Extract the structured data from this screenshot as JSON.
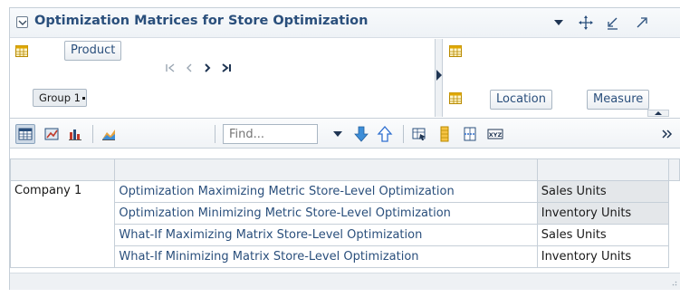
{
  "header": {
    "title": "Optimization Matrices for Store Optimization"
  },
  "pivot": {
    "row_dimension": "Product",
    "row_member": "Group 1",
    "column_dimensions": [
      "Location",
      "Measure"
    ]
  },
  "toolbar": {
    "find_placeholder": "Find..."
  },
  "matrix": {
    "company": "Company 1",
    "rows": [
      {
        "name": "Optimization Maximizing Metric Store-Level Optimization",
        "measure": "Sales Units"
      },
      {
        "name": "Optimization Minimizing Metric Store-Level Optimization",
        "measure": "Inventory Units"
      },
      {
        "name": "What-If Maximizing Matrix Store-Level Optimization",
        "measure": "Sales Units"
      },
      {
        "name": "What-If Minimizing Matrix Store-Level Optimization",
        "measure": "Inventory Units"
      }
    ]
  },
  "colors": {
    "title": "#2a4f7c",
    "border": "#c6cfd8",
    "accent_blue": "#2f6fd0"
  }
}
